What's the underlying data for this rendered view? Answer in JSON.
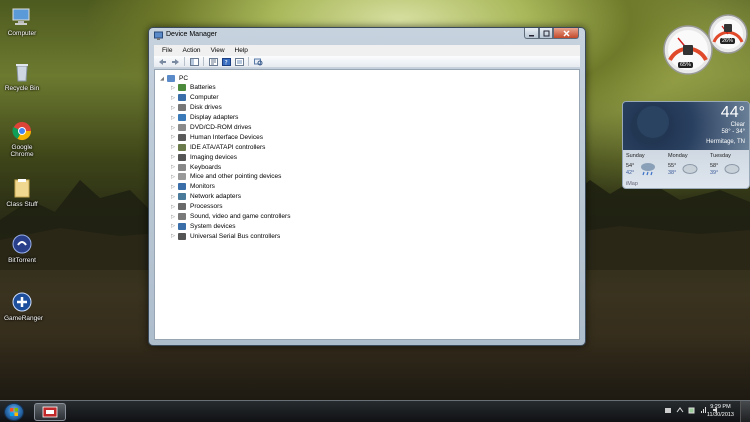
{
  "desktop": {
    "icons": [
      {
        "label": "Computer"
      },
      {
        "label": "Recycle Bin"
      },
      {
        "label": "Google Chrome"
      },
      {
        "label": "Class Stuff"
      },
      {
        "label": "BitTorrent"
      },
      {
        "label": "GameRanger"
      }
    ]
  },
  "window": {
    "title": "Device Manager",
    "menu": [
      "File",
      "Action",
      "View",
      "Help"
    ],
    "tree": {
      "root": "PC",
      "items": [
        {
          "label": "Batteries",
          "icon": "battery-icon",
          "color": "#4a8a3a"
        },
        {
          "label": "Computer",
          "icon": "computer-icon",
          "color": "#3a6ea8"
        },
        {
          "label": "Disk drives",
          "icon": "disk-drive-icon",
          "color": "#777777"
        },
        {
          "label": "Display adapters",
          "icon": "display-adapter-icon",
          "color": "#3a7ab8"
        },
        {
          "label": "DVD/CD-ROM drives",
          "icon": "dvd-drive-icon",
          "color": "#8a8a8a"
        },
        {
          "label": "Human Interface Devices",
          "icon": "hid-icon",
          "color": "#5a5a5a"
        },
        {
          "label": "IDE ATA/ATAPI controllers",
          "icon": "ide-controller-icon",
          "color": "#6a7a4a"
        },
        {
          "label": "Imaging devices",
          "icon": "camera-icon",
          "color": "#555555"
        },
        {
          "label": "Keyboards",
          "icon": "keyboard-icon",
          "color": "#888888"
        },
        {
          "label": "Mice and other pointing devices",
          "icon": "mouse-icon",
          "color": "#999999"
        },
        {
          "label": "Monitors",
          "icon": "monitor-icon",
          "color": "#3a6ea8"
        },
        {
          "label": "Network adapters",
          "icon": "network-adapter-icon",
          "color": "#4a7a9a"
        },
        {
          "label": "Processors",
          "icon": "processor-icon",
          "color": "#6a6a6a"
        },
        {
          "label": "Sound, video and game controllers",
          "icon": "sound-icon",
          "color": "#7a7a7a"
        },
        {
          "label": "System devices",
          "icon": "system-device-icon",
          "color": "#3a6ea8"
        },
        {
          "label": "Universal Serial Bus controllers",
          "icon": "usb-icon",
          "color": "#555555"
        }
      ]
    }
  },
  "gadgets": {
    "cpu_meter": {
      "cpu": "65%",
      "memory": "26%"
    },
    "weather": {
      "temp": "44°",
      "condition": "Clear",
      "range": "58° - 34°",
      "location": "Hermitage, TN",
      "days": [
        {
          "name": "Sunday",
          "hi": "54°",
          "lo": "42°"
        },
        {
          "name": "Monday",
          "hi": "55°",
          "lo": "38°"
        },
        {
          "name": "Tuesday",
          "hi": "58°",
          "lo": "39°"
        }
      ],
      "footer": "iMap"
    }
  },
  "taskbar": {
    "time": "9:29 PM",
    "date": "11/30/2013"
  }
}
